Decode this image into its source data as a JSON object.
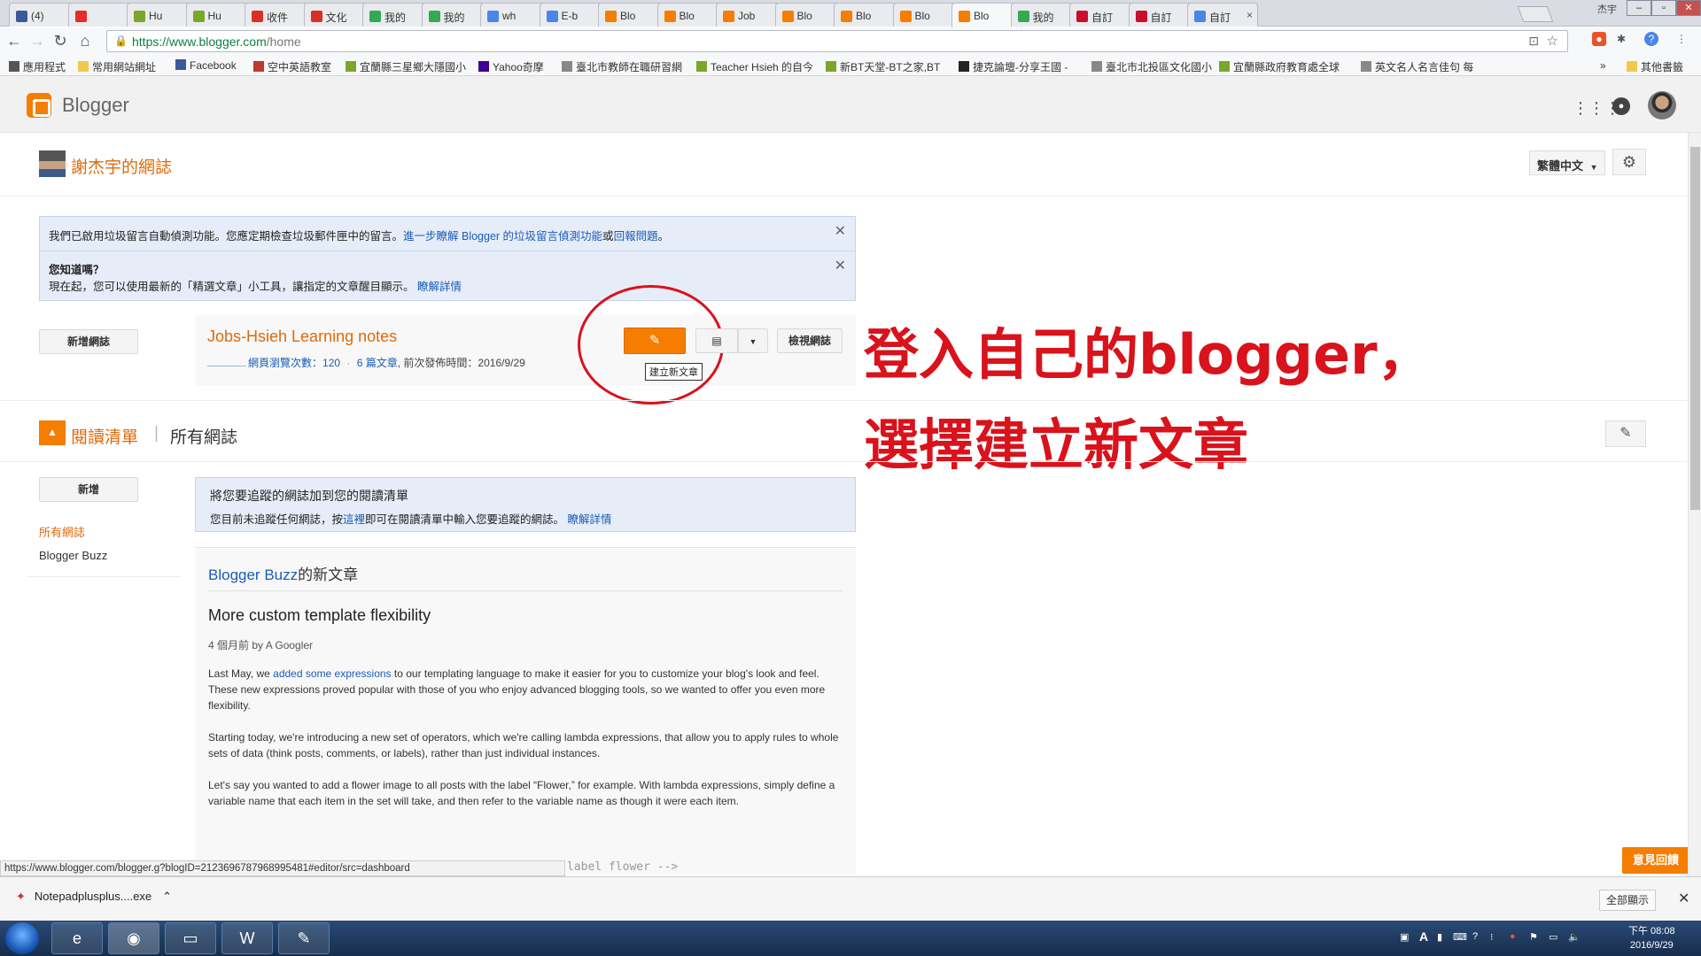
{
  "browser": {
    "tabs": [
      {
        "label": "(4)",
        "color": "#3b5998"
      },
      {
        "label": "",
        "color": "#e52d27"
      },
      {
        "label": "Hu",
        "color": "#7aa72a"
      },
      {
        "label": "Hu",
        "color": "#7aa72a"
      },
      {
        "label": "收件",
        "color": "#d93025"
      },
      {
        "label": "文化",
        "color": "#d93025"
      },
      {
        "label": "我的",
        "color": "#34a853"
      },
      {
        "label": "我的",
        "color": "#34a853"
      },
      {
        "label": "wh",
        "color": "#4a86e8"
      },
      {
        "label": "E-b",
        "color": "#4a86e8"
      },
      {
        "label": "Blo",
        "color": "#f57d00"
      },
      {
        "label": "Blo",
        "color": "#f57d00"
      },
      {
        "label": "Job",
        "color": "#f57d00"
      },
      {
        "label": "Blo",
        "color": "#f57d00"
      },
      {
        "label": "Blo",
        "color": "#f57d00"
      },
      {
        "label": "Blo",
        "color": "#f57d00"
      },
      {
        "label": "Blo",
        "color": "#f57d00",
        "active": true
      },
      {
        "label": "我的",
        "color": "#34a853"
      },
      {
        "label": "自訂",
        "color": "#c8102e"
      },
      {
        "label": "自訂",
        "color": "#c8102e"
      },
      {
        "label": "自訂",
        "color": "#4a86e8"
      }
    ],
    "window_user": "杰宇",
    "url_host": "https://www.blogger.com",
    "url_path": "/home",
    "bookmarks": [
      {
        "label": "應用程式",
        "icon": "apps-grid-icon",
        "color": "#555"
      },
      {
        "label": "常用網站網址",
        "icon": "folder-icon",
        "color": "#f2c94c"
      },
      {
        "label": "Facebook",
        "icon": "facebook-icon",
        "color": "#3b5998"
      },
      {
        "label": "空中英語教室",
        "icon": "radio-icon",
        "color": "#c0392b"
      },
      {
        "label": "宜蘭縣三星鄉大隱國小",
        "icon": "y-icon",
        "color": "#7aa72a"
      },
      {
        "label": "Yahoo奇摩",
        "icon": "yahoo-icon",
        "color": "#400090"
      },
      {
        "label": "臺北市教師在職研習網",
        "icon": "page-icon",
        "color": "#888"
      },
      {
        "label": "Teacher Hsieh 的自今",
        "icon": "y-icon",
        "color": "#7aa72a"
      },
      {
        "label": "新BT天堂-BT之家,BT",
        "icon": "leaf-icon",
        "color": "#7aa72a"
      },
      {
        "label": "捷克論壇-分享王國 -",
        "icon": "jk-icon",
        "color": "#222"
      },
      {
        "label": "臺北市北投區文化國小",
        "icon": "page-icon",
        "color": "#888"
      },
      {
        "label": "宜蘭縣政府教育處全球",
        "icon": "y-icon",
        "color": "#7aa72a"
      },
      {
        "label": "英文名人名言佳句 每",
        "icon": "page-icon",
        "color": "#888"
      }
    ],
    "bookmarks_more": "»",
    "other_bookmarks": "其他書籤"
  },
  "blogger": {
    "brand": "Blogger",
    "blog_name": "謝杰宇的網誌",
    "language": "繁體中文",
    "notice1": {
      "text": "我們已啟用垃圾留言自動偵測功能。您應定期檢查垃圾郵件匣中的留言。",
      "link1": "進一步瞭解 Blogger 的垃圾留言偵測功能",
      "mid": "或",
      "link2": "回報問題",
      "end": "。"
    },
    "notice2": {
      "title": "您知道嗎？",
      "text": "現在起，您可以使用最新的「精選文章」小工具，讓指定的文章醒目顯示。",
      "link": "瞭解詳情"
    },
    "new_blog_button": "新增網誌",
    "card": {
      "title": "Jobs-Hsieh Learning notes",
      "pageviews_label": "網頁瀏覽次數：",
      "pageviews": "120",
      "sep": "·",
      "posts": "6 篇文章",
      "last_published": ", 前次發佈時間：2016/9/29",
      "new_post_tooltip": "建立新文章",
      "view_blog": "檢視網誌"
    },
    "annotation_line1": "登入自己的blogger，",
    "annotation_line2": "選擇建立新文章",
    "reading_list": {
      "title": "閱讀清單",
      "all": "所有網誌",
      "add_button": "新增",
      "side_links": [
        "所有網誌",
        "Blogger Buzz"
      ],
      "info_title": "將您要追蹤的網誌加到您的閱讀清單",
      "info_text1": "您目前未追蹤任何網誌，按",
      "info_link1": "這裡",
      "info_text2": "即可在閱讀清單中輸入您要追蹤的網誌。",
      "info_link2": "瞭解詳情"
    },
    "feed": {
      "source": "Blogger Buzz",
      "source_suffix": "的新文章",
      "post_title": "More custom template flexibility",
      "meta": "4 個月前 by A Googler",
      "p1_a": "Last May, we ",
      "p1_link": "added some expressions",
      "p1_b": " to our templating language to make it easier for you to customize your blog's look and feel. These new expressions proved popular with those of you who enjoy advanced blogging tools, so we wanted to offer you even more flexibility.",
      "p2": "Starting today, we're introducing a new set of operators, which we're calling lambda expressions, that allow you to apply rules to whole sets of data (think posts, comments, or labels), rather than just individual instances.",
      "p3": "Let's say you wanted to add a flower image to all posts with the label “Flower,” for example. With lambda expressions, simply define a variable name that each item in the set will take, and then refer to the variable name as though it were each item.",
      "code_fragment": "label flower -->"
    },
    "status_url": "https://www.blogger.com/blogger.g?blogID=2123696787968995481#editor/src=dashboard",
    "feedback_button": "意見回饋"
  },
  "downloads": {
    "file": "Notepadplusplus....exe",
    "show_all": "全部顯示"
  },
  "taskbar": {
    "clock_time": "下午 08:08",
    "clock_date": "2016/9/29"
  },
  "colors": {
    "accent": "#f57d00",
    "annotation": "#d9121b",
    "link": "#1a5cb8"
  }
}
